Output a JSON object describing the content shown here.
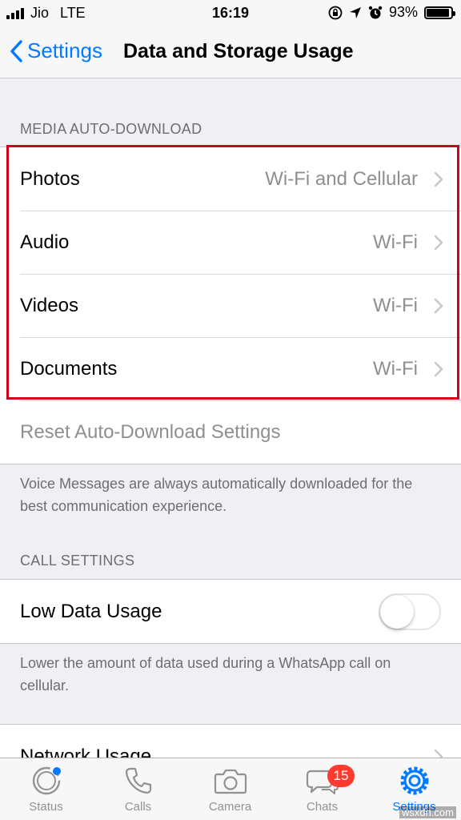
{
  "status_bar": {
    "carrier": "Jio",
    "network": "LTE",
    "time": "16:19",
    "battery": "93%",
    "battery_level": 0.93
  },
  "nav": {
    "back_label": "Settings",
    "title": "Data and Storage Usage"
  },
  "media_section": {
    "header": "MEDIA AUTO-DOWNLOAD",
    "rows": [
      {
        "label": "Photos",
        "value": "Wi-Fi and Cellular"
      },
      {
        "label": "Audio",
        "value": "Wi-Fi"
      },
      {
        "label": "Videos",
        "value": "Wi-Fi"
      },
      {
        "label": "Documents",
        "value": "Wi-Fi"
      }
    ],
    "reset_label": "Reset Auto-Download Settings",
    "footer": "Voice Messages are always automatically downloaded for the best communication experience."
  },
  "call_section": {
    "header": "CALL SETTINGS",
    "low_data_label": "Low Data Usage",
    "low_data_enabled": false,
    "footer": "Lower the amount of data used during a WhatsApp call on cellular."
  },
  "network_usage_label": "Network Usage",
  "tabs": [
    {
      "label": "Status",
      "icon": "status-icon"
    },
    {
      "label": "Calls",
      "icon": "phone-icon"
    },
    {
      "label": "Camera",
      "icon": "camera-icon"
    },
    {
      "label": "Chats",
      "icon": "chat-bubbles-icon",
      "badge": "15"
    },
    {
      "label": "Settings",
      "icon": "gear-icon",
      "active": true
    }
  ],
  "colors": {
    "accent": "#007aff",
    "highlight": "#d0021b",
    "badge": "#ff3b30"
  },
  "watermark": "wsxdn.com"
}
